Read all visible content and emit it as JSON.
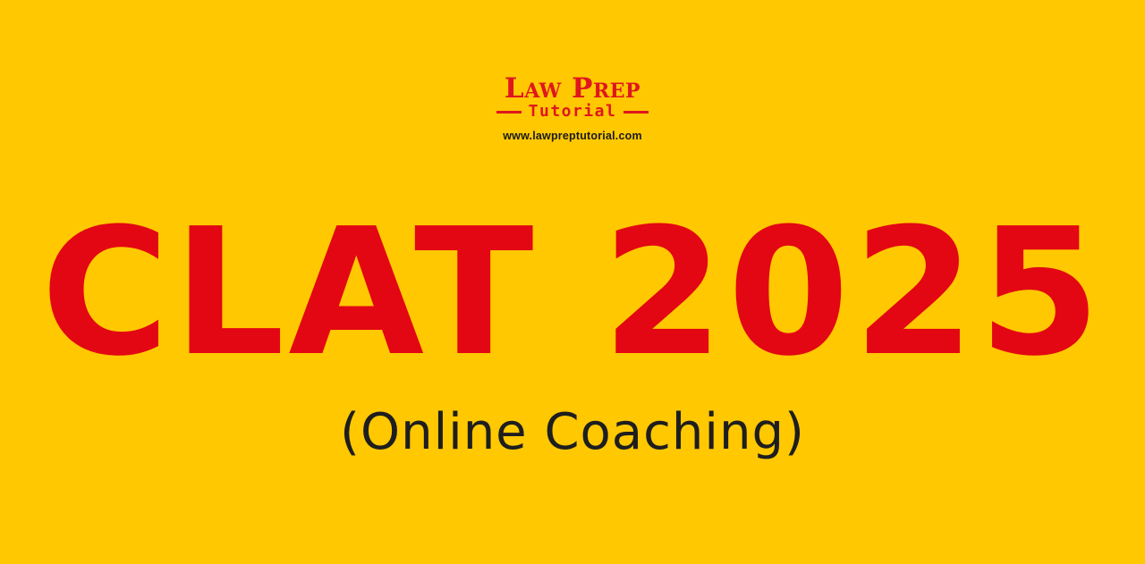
{
  "logo": {
    "wordmark": "Law Prep",
    "subtitle": "Tutorial",
    "url": "www.lawpreptutorial.com"
  },
  "headline": "CLAT 2025",
  "subheading": "(Online Coaching)",
  "colors": {
    "background": "#FFC800",
    "brand_red": "#E30613",
    "text_dark": "#1E1E1E"
  }
}
